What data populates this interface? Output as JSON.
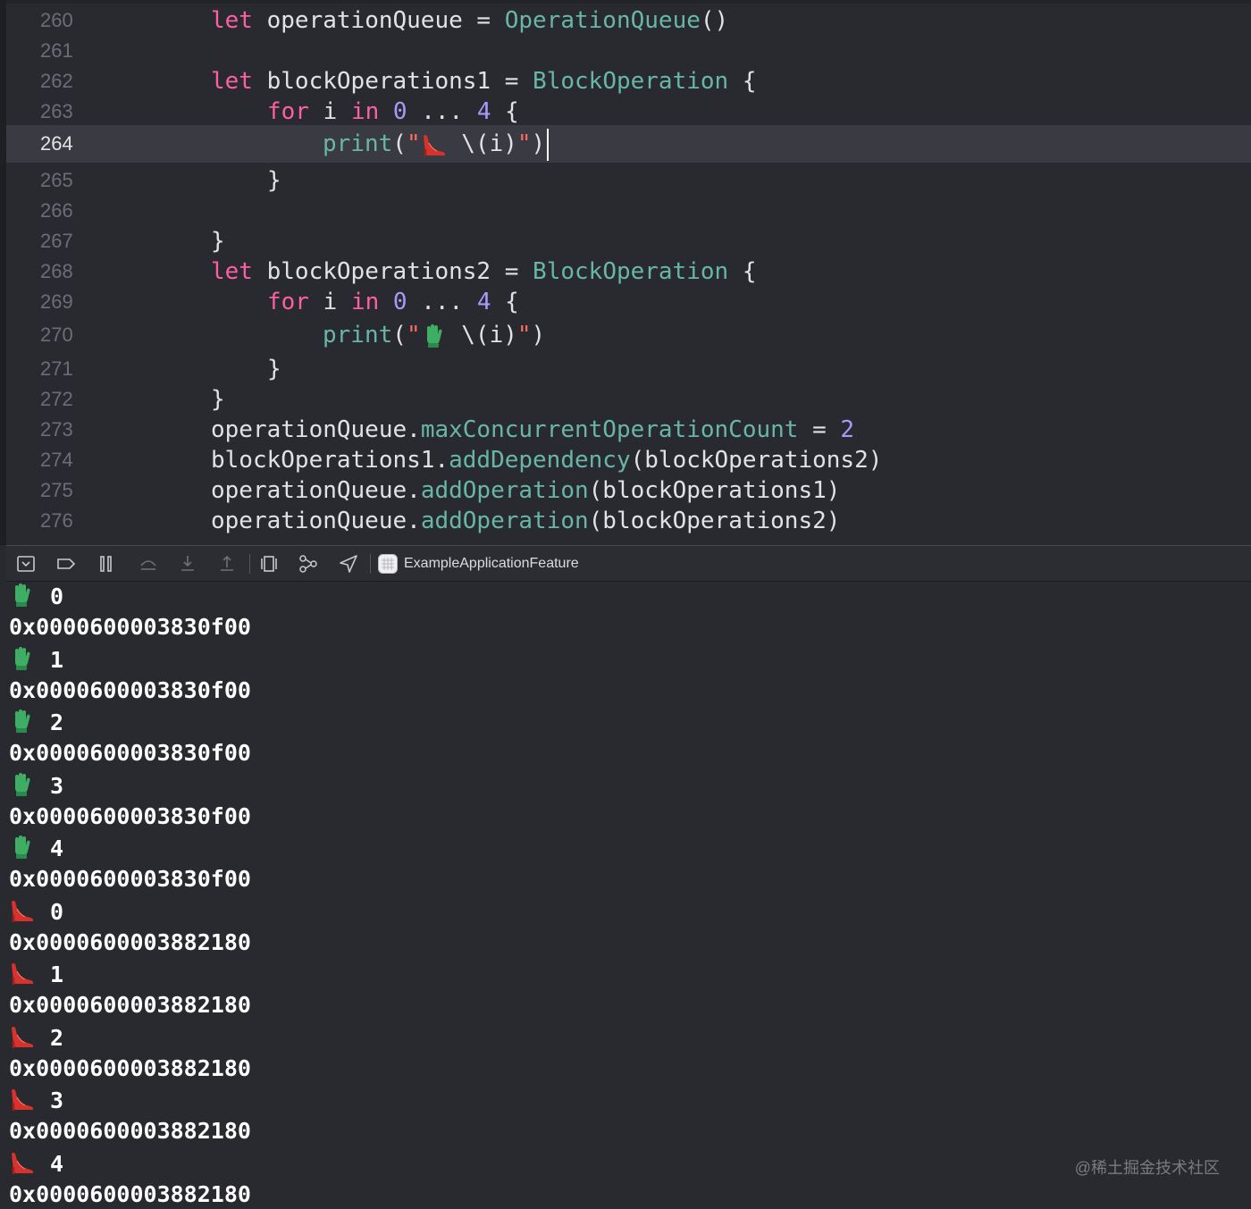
{
  "editor": {
    "lines": [
      {
        "no": "260",
        "parts": [
          {
            "t": "let",
            "c": "kw"
          },
          {
            "t": " operationQueue = ",
            "c": ""
          },
          {
            "t": "OperationQueue",
            "c": "ty"
          },
          {
            "t": "()",
            "c": ""
          }
        ]
      },
      {
        "no": "261",
        "parts": []
      },
      {
        "no": "262",
        "parts": [
          {
            "t": "let",
            "c": "kw"
          },
          {
            "t": " blockOperations1 = ",
            "c": ""
          },
          {
            "t": "BlockOperation",
            "c": "ty"
          },
          {
            "t": " {",
            "c": ""
          }
        ]
      },
      {
        "no": "263",
        "parts": [
          {
            "t": "for",
            "c": "kw"
          },
          {
            "t": " i ",
            "c": ""
          },
          {
            "t": "in",
            "c": "kw"
          },
          {
            "t": " ",
            "c": ""
          },
          {
            "t": "0",
            "c": "num"
          },
          {
            "t": " ... ",
            "c": ""
          },
          {
            "t": "4",
            "c": "num"
          },
          {
            "t": " {",
            "c": ""
          }
        ]
      },
      {
        "no": "264",
        "parts": [
          {
            "t": "print",
            "c": "fn"
          },
          {
            "t": "(",
            "c": ""
          },
          {
            "t": "\"",
            "c": "str"
          },
          {
            "emoji": "heel"
          },
          {
            "t": " \\(",
            "c": ""
          },
          {
            "t": "i",
            "c": ""
          },
          {
            "t": ")",
            "c": ""
          },
          {
            "t": "\"",
            "c": "str"
          },
          {
            "t": ")",
            "c": ""
          }
        ]
      },
      {
        "no": "265",
        "parts": [
          {
            "t": "}",
            "c": ""
          }
        ]
      },
      {
        "no": "266",
        "parts": []
      },
      {
        "no": "267",
        "parts": [
          {
            "t": "}",
            "c": ""
          }
        ]
      },
      {
        "no": "268",
        "parts": [
          {
            "t": "let",
            "c": "kw"
          },
          {
            "t": " blockOperations2 = ",
            "c": ""
          },
          {
            "t": "BlockOperation",
            "c": "ty"
          },
          {
            "t": " {",
            "c": ""
          }
        ]
      },
      {
        "no": "269",
        "parts": [
          {
            "t": "for",
            "c": "kw"
          },
          {
            "t": " i ",
            "c": ""
          },
          {
            "t": "in",
            "c": "kw"
          },
          {
            "t": " ",
            "c": ""
          },
          {
            "t": "0",
            "c": "num"
          },
          {
            "t": " ... ",
            "c": ""
          },
          {
            "t": "4",
            "c": "num"
          },
          {
            "t": " {",
            "c": ""
          }
        ]
      },
      {
        "no": "270",
        "parts": [
          {
            "t": "print",
            "c": "fn"
          },
          {
            "t": "(",
            "c": ""
          },
          {
            "t": "\"",
            "c": "str"
          },
          {
            "emoji": "glove"
          },
          {
            "t": " \\(",
            "c": ""
          },
          {
            "t": "i",
            "c": ""
          },
          {
            "t": ")",
            "c": ""
          },
          {
            "t": "\"",
            "c": "str"
          },
          {
            "t": ")",
            "c": ""
          }
        ]
      },
      {
        "no": "271",
        "parts": [
          {
            "t": "}",
            "c": ""
          }
        ]
      },
      {
        "no": "272",
        "parts": [
          {
            "t": "}",
            "c": ""
          }
        ]
      },
      {
        "no": "273",
        "parts": [
          {
            "t": "operationQueue.",
            "c": ""
          },
          {
            "t": "maxConcurrentOperationCount",
            "c": "fn"
          },
          {
            "t": " = ",
            "c": ""
          },
          {
            "t": "2",
            "c": "num"
          }
        ]
      },
      {
        "no": "274",
        "parts": [
          {
            "t": "blockOperations1.",
            "c": ""
          },
          {
            "t": "addDependency",
            "c": "fn"
          },
          {
            "t": "(blockOperations2)",
            "c": ""
          }
        ]
      },
      {
        "no": "275",
        "parts": [
          {
            "t": "operationQueue.",
            "c": ""
          },
          {
            "t": "addOperation",
            "c": "fn"
          },
          {
            "t": "(blockOperations1)",
            "c": ""
          }
        ]
      },
      {
        "no": "276",
        "parts": [
          {
            "t": "operationQueue.",
            "c": ""
          },
          {
            "t": "addOperation",
            "c": "fn"
          },
          {
            "t": "(blockOperations2)",
            "c": ""
          }
        ]
      }
    ],
    "current_line": "264"
  },
  "debugbar": {
    "icons": [
      "hide-debug-area-icon",
      "breakpoints-toggle-icon",
      "pause-icon",
      "step-over-icon",
      "step-into-icon",
      "step-out-icon",
      "view-hierarchy-icon",
      "memory-graph-icon",
      "simulate-location-icon"
    ],
    "target_label": "ExampleApplicationFeature"
  },
  "console": {
    "entries": [
      {
        "emoji": "glove",
        "index": "0",
        "address": "0x0000600003830f00"
      },
      {
        "emoji": "glove",
        "index": "1",
        "address": "0x0000600003830f00"
      },
      {
        "emoji": "glove",
        "index": "2",
        "address": "0x0000600003830f00"
      },
      {
        "emoji": "glove",
        "index": "3",
        "address": "0x0000600003830f00"
      },
      {
        "emoji": "glove",
        "index": "4",
        "address": "0x0000600003830f00"
      },
      {
        "emoji": "heel",
        "index": "0",
        "address": "0x0000600003882180"
      },
      {
        "emoji": "heel",
        "index": "1",
        "address": "0x0000600003882180"
      },
      {
        "emoji": "heel",
        "index": "2",
        "address": "0x0000600003882180"
      },
      {
        "emoji": "heel",
        "index": "3",
        "address": "0x0000600003882180"
      },
      {
        "emoji": "heel",
        "index": "4",
        "address": "0x0000600003882180"
      }
    ]
  },
  "watermark": "@稀土掘金技术社区",
  "colors": {
    "background": "#292a30",
    "keyword": "#fc5fa3",
    "type": "#67b7a4",
    "number": "#a59bfa",
    "string": "#fc6a5d"
  }
}
